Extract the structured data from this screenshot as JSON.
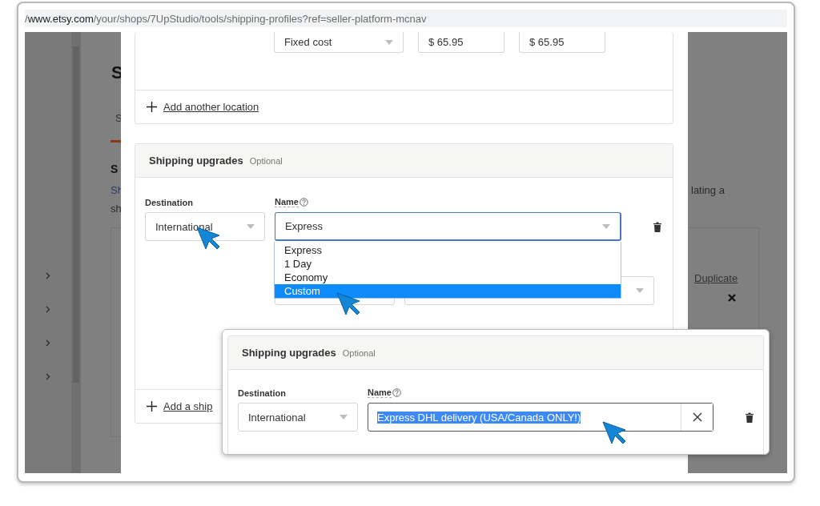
{
  "address_bar": {
    "url_prefix": "/",
    "url_host": "www.etsy.com",
    "url_path": "/your/shops/7UpStudio/tools/shipping-profiles?ref=seller-platform-mcnav"
  },
  "background_page": {
    "title_fragment": "S",
    "tab_fragment": "S",
    "heading_fragment": "S",
    "text_fragments": [
      "Sh",
      "sh"
    ],
    "side_text": "lating a",
    "duplicate_link": "Duplicate"
  },
  "modal": {
    "pricing_row": {
      "type_select": "Fixed cost",
      "prices": [
        {
          "currency": "$",
          "value": "65.95"
        },
        {
          "currency": "$",
          "value": "65.95"
        }
      ]
    },
    "add_location_link": "Add another location",
    "upgrades": {
      "title": "Shipping upgrades",
      "badge": "Optional",
      "destination_label": "Destination",
      "destination_value": "International",
      "name_label": "Name",
      "name_value": "Express",
      "name_options": [
        {
          "label": "Express",
          "selected": false
        },
        {
          "label": "1 Day",
          "selected": false
        },
        {
          "label": "Economy",
          "selected": false
        },
        {
          "label": "Custom",
          "selected": true
        }
      ],
      "add_link": "Add a ship"
    }
  },
  "callout": {
    "title": "Shipping upgrades",
    "badge": "Optional",
    "destination_label": "Destination",
    "destination_value": "International",
    "name_label": "Name",
    "name_value": "Express DHL delivery (USA/Canada ONLY!)"
  }
}
